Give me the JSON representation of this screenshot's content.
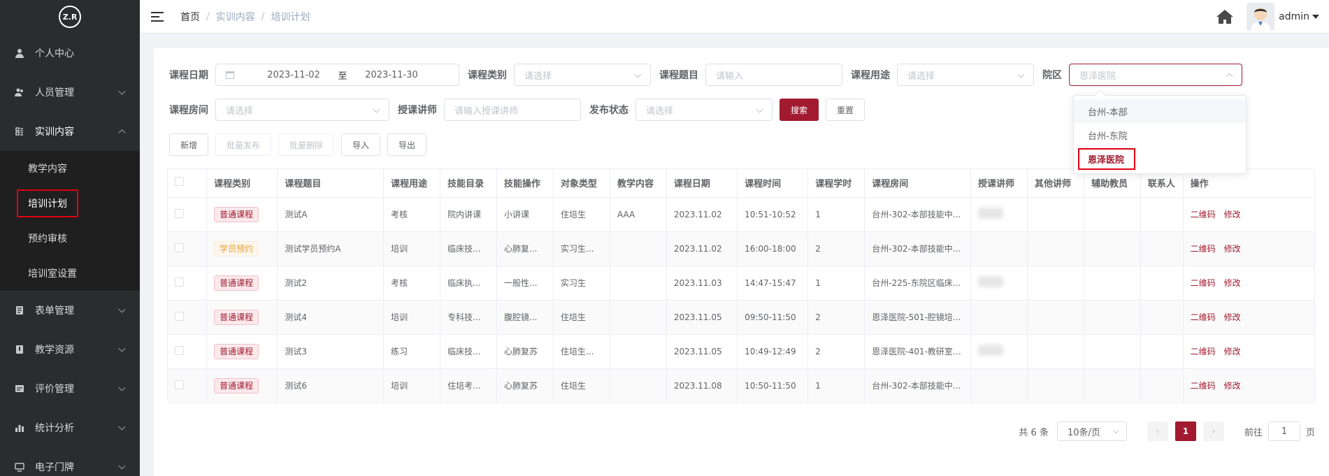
{
  "sidebar": {
    "logo_text": "Z.R",
    "items": [
      {
        "label": "个人中心",
        "icon": "user-icon"
      },
      {
        "label": "人员管理",
        "icon": "people-icon"
      },
      {
        "label": "实训内容",
        "icon": "content-icon"
      },
      {
        "label": "表单管理",
        "icon": "form-icon"
      },
      {
        "label": "教学资源",
        "icon": "resource-icon"
      },
      {
        "label": "评价管理",
        "icon": "evaluate-icon"
      },
      {
        "label": "统计分析",
        "icon": "chart-icon"
      },
      {
        "label": "电子门牌",
        "icon": "monitor-icon"
      }
    ],
    "submenu": [
      "教学内容",
      "培训计划",
      "预约审核",
      "培训室设置"
    ]
  },
  "header": {
    "breadcrumb": [
      "首页",
      "实训内容",
      "培训计划"
    ],
    "user": "admin"
  },
  "filters": {
    "date_label": "课程日期",
    "date_start": "2023-11-02",
    "date_sep": "至",
    "date_end": "2023-11-30",
    "category_label": "课程类别",
    "category_placeholder": "请选择",
    "title_label": "课程题目",
    "title_placeholder": "请输入",
    "purpose_label": "课程用途",
    "purpose_placeholder": "请选择",
    "campus_label": "院区",
    "campus_placeholder": "恩泽医院",
    "room_label": "课程房间",
    "room_placeholder": "请选择",
    "teacher_label": "授课讲师",
    "teacher_placeholder": "请输入授课讲师",
    "status_label": "发布状态",
    "status_placeholder": "请选择",
    "search_btn": "搜索",
    "reset_btn": "重置"
  },
  "toolbar": {
    "add": "新增",
    "batch_publish": "批量发布",
    "batch_delete": "批量删除",
    "import": "导入",
    "export": "导出"
  },
  "table": {
    "headers": [
      "课程类别",
      "课程题目",
      "课程用途",
      "技能目录",
      "技能操作",
      "对象类型",
      "教学内容",
      "课程日期",
      "课程时间",
      "课程学时",
      "课程房间",
      "授课讲师",
      "其他讲师",
      "辅助教员",
      "联系人",
      "操作"
    ],
    "op_qrcode": "二维码",
    "op_edit": "修改",
    "rows": [
      {
        "category": "普通课程",
        "type": "normal",
        "title": "测试A",
        "purpose": "考核",
        "skill_dir": "院内讲课",
        "skill_op": "小讲课",
        "target": "住培生",
        "teach": "AAA",
        "date": "2023.11.02",
        "time": "10:51-10:52",
        "hours": "1",
        "room": "台州-302-本部技能中...",
        "teacher_blur": true
      },
      {
        "category": "学员预约",
        "type": "student",
        "title": "测试学员预约A",
        "purpose": "培训",
        "skill_dir": "临床技...",
        "skill_op": "心肺复...",
        "target": "实习生...",
        "teach": "",
        "date": "2023.11.02",
        "time": "16:00-18:00",
        "hours": "2",
        "room": "台州-302-本部技能中...",
        "teacher_blur": false
      },
      {
        "category": "普通课程",
        "type": "normal",
        "title": "测试2",
        "purpose": "考核",
        "skill_dir": "临床执...",
        "skill_op": "一般性...",
        "target": "实习生",
        "teach": "",
        "date": "2023.11.03",
        "time": "14:47-15:47",
        "hours": "1",
        "room": "台州-225-东院区临床...",
        "teacher_blur": true
      },
      {
        "category": "普通课程",
        "type": "normal",
        "title": "测试4",
        "purpose": "培训",
        "skill_dir": "专科技...",
        "skill_op": "腹腔镜...",
        "target": "住培生",
        "teach": "",
        "date": "2023.11.05",
        "time": "09:50-11:50",
        "hours": "2",
        "room": "恩泽医院-501-腔镜培...",
        "teacher_blur": false
      },
      {
        "category": "普通课程",
        "type": "normal",
        "title": "测试3",
        "purpose": "练习",
        "skill_dir": "临床技...",
        "skill_op": "心肺复苏",
        "target": "住培生...",
        "teach": "",
        "date": "2023.11.05",
        "time": "10:49-12:49",
        "hours": "2",
        "room": "恩泽医院-401-教研室/...",
        "teacher_blur": true
      },
      {
        "category": "普通课程",
        "type": "normal",
        "title": "测试6",
        "purpose": "培训",
        "skill_dir": "住培考...",
        "skill_op": "心肺复苏",
        "target": "住培生",
        "teach": "",
        "date": "2023.11.08",
        "time": "10:50-11:50",
        "hours": "1",
        "room": "台州-302-本部技能中...",
        "teacher_blur": false
      }
    ]
  },
  "pagination": {
    "total": "共 6 条",
    "page_size": "10条/页",
    "current": "1",
    "goto_label": "前往",
    "goto_value": "1",
    "page_unit": "页"
  },
  "dropdown": {
    "options": [
      "台州-本部",
      "台州-东院",
      "恩泽医院"
    ]
  },
  "colors": {
    "accent": "#a11a2f",
    "sidebar_bg": "#2b2c2e",
    "highlight_box": "#e0000f"
  }
}
